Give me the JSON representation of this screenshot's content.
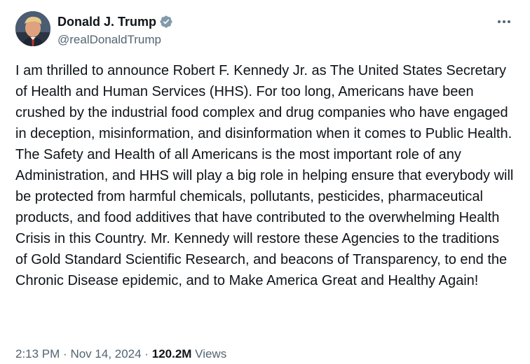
{
  "author": {
    "display_name": "Donald J. Trump",
    "handle": "@realDonaldTrump",
    "avatar": "profile-photo",
    "verified": true,
    "verified_icon": "verified-badge-icon",
    "verified_color": "#829aab"
  },
  "menu": {
    "icon": "more-options-icon"
  },
  "tweet": {
    "text": "I am thrilled to announce Robert F. Kennedy Jr. as The United States Secretary of Health and Human Services (HHS). For too long, Americans have been crushed by the industrial food complex and drug companies who have engaged in deception, misinformation, and disinformation when it comes to Public Health. The Safety and Health of all Americans is the most important role of any Administration, and HHS will play a big role in helping ensure that everybody will be protected from harmful chemicals, pollutants, pesticides, pharmaceutical products, and food additives that have contributed to the overwhelming Health Crisis in this Country. Mr. Kennedy will restore these Agencies to the traditions of Gold Standard Scientific Research, and beacons of Transparency, to end the Chronic Disease epidemic, and to Make America Great and Healthy Again!"
  },
  "meta": {
    "time": "2:13 PM",
    "separator": "·",
    "date": "Nov 14, 2024",
    "views_count": "120.2M",
    "views_label": "Views"
  },
  "colors": {
    "text_primary": "#0f1419",
    "text_secondary": "#536471",
    "background": "#ffffff"
  }
}
